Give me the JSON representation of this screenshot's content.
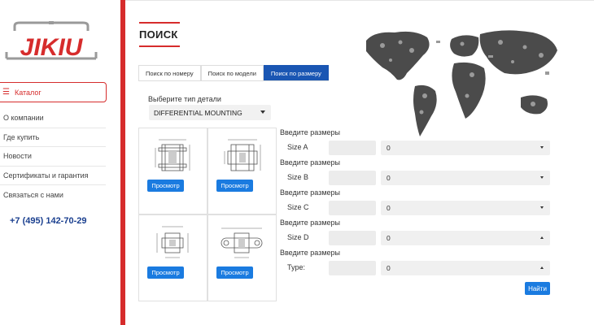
{
  "brand": {
    "logo_text": "JIKIU",
    "color": "#d62c2c"
  },
  "sidebar": {
    "catalog_label": "Каталог",
    "items": [
      {
        "label": "О компании"
      },
      {
        "label": "Где купить"
      },
      {
        "label": "Новости"
      },
      {
        "label": "Сертификаты и гарантия"
      },
      {
        "label": "Связаться с нами"
      }
    ],
    "phone": "+7 (495) 142-70-29"
  },
  "page": {
    "title": "ПОИСК"
  },
  "tabs": [
    {
      "label": "Поиск по номеру",
      "active": false
    },
    {
      "label": "Поиск по модели",
      "active": false
    },
    {
      "label": "Поиск по размеру",
      "active": true
    }
  ],
  "part_type": {
    "label": "Выберите тип детали",
    "value": "DIFFERENTIAL MOUNTING"
  },
  "cards": {
    "view_label": "Просмотр"
  },
  "sizes": [
    {
      "heading": "Введите размеры",
      "label": "Size A",
      "value": "0",
      "open": false
    },
    {
      "heading": "Введите размеры",
      "label": "Size B",
      "value": "0",
      "open": false
    },
    {
      "heading": "Введите размеры",
      "label": "Size C",
      "value": "0",
      "open": false
    },
    {
      "heading": "Введите размеры",
      "label": "Size D",
      "value": "0",
      "open": true
    },
    {
      "heading": "Введите размеры",
      "label": "Type:",
      "value": "0",
      "open": true
    }
  ],
  "find_label": "Найти",
  "colors": {
    "accent": "#d62c2c",
    "primary": "#1a7be0",
    "tab_active": "#1a56b3",
    "phone": "#1a3f8f"
  }
}
